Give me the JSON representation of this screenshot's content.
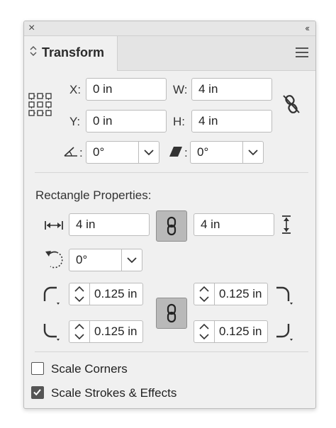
{
  "panel": {
    "close_glyph": "×",
    "collapse_glyph": "‹‹",
    "tab_label": "Transform"
  },
  "transform": {
    "x_label": "X:",
    "x_value": "0 in",
    "y_label": "Y:",
    "y_value": "0 in",
    "w_label": "W:",
    "w_value": "4 in",
    "h_label": "H:",
    "h_value": "4 in",
    "rotate_angle": "0°",
    "shear_angle": "0°",
    "colon": ":"
  },
  "rectangle": {
    "title": "Rectangle Properties:",
    "width_value": "4 in",
    "height_value": "4 in",
    "rotation_value": "0°",
    "corner_tl": "0.125 in",
    "corner_tr": "0.125 in",
    "corner_bl": "0.125 in",
    "corner_br": "0.125 in"
  },
  "options": {
    "scale_corners_label": "Scale Corners",
    "scale_corners_checked": false,
    "scale_strokes_label": "Scale Strokes & Effects",
    "scale_strokes_checked": true
  },
  "icons": {
    "reference_point": "reference-point-icon",
    "unlink": "unlink-icon",
    "link": "link-icon",
    "rotate": "angle-icon",
    "shear": "shear-icon",
    "width": "width-arrows-icon",
    "height": "height-arrows-icon",
    "shape_angle": "rotate-arrow-icon",
    "corner": "corner-icon",
    "chevron": "chevron-down-icon"
  },
  "colors": {
    "panel_bg": "#f0f0f0",
    "link_button_bg": "#b9b9b9",
    "border": "#bcbcbc"
  }
}
